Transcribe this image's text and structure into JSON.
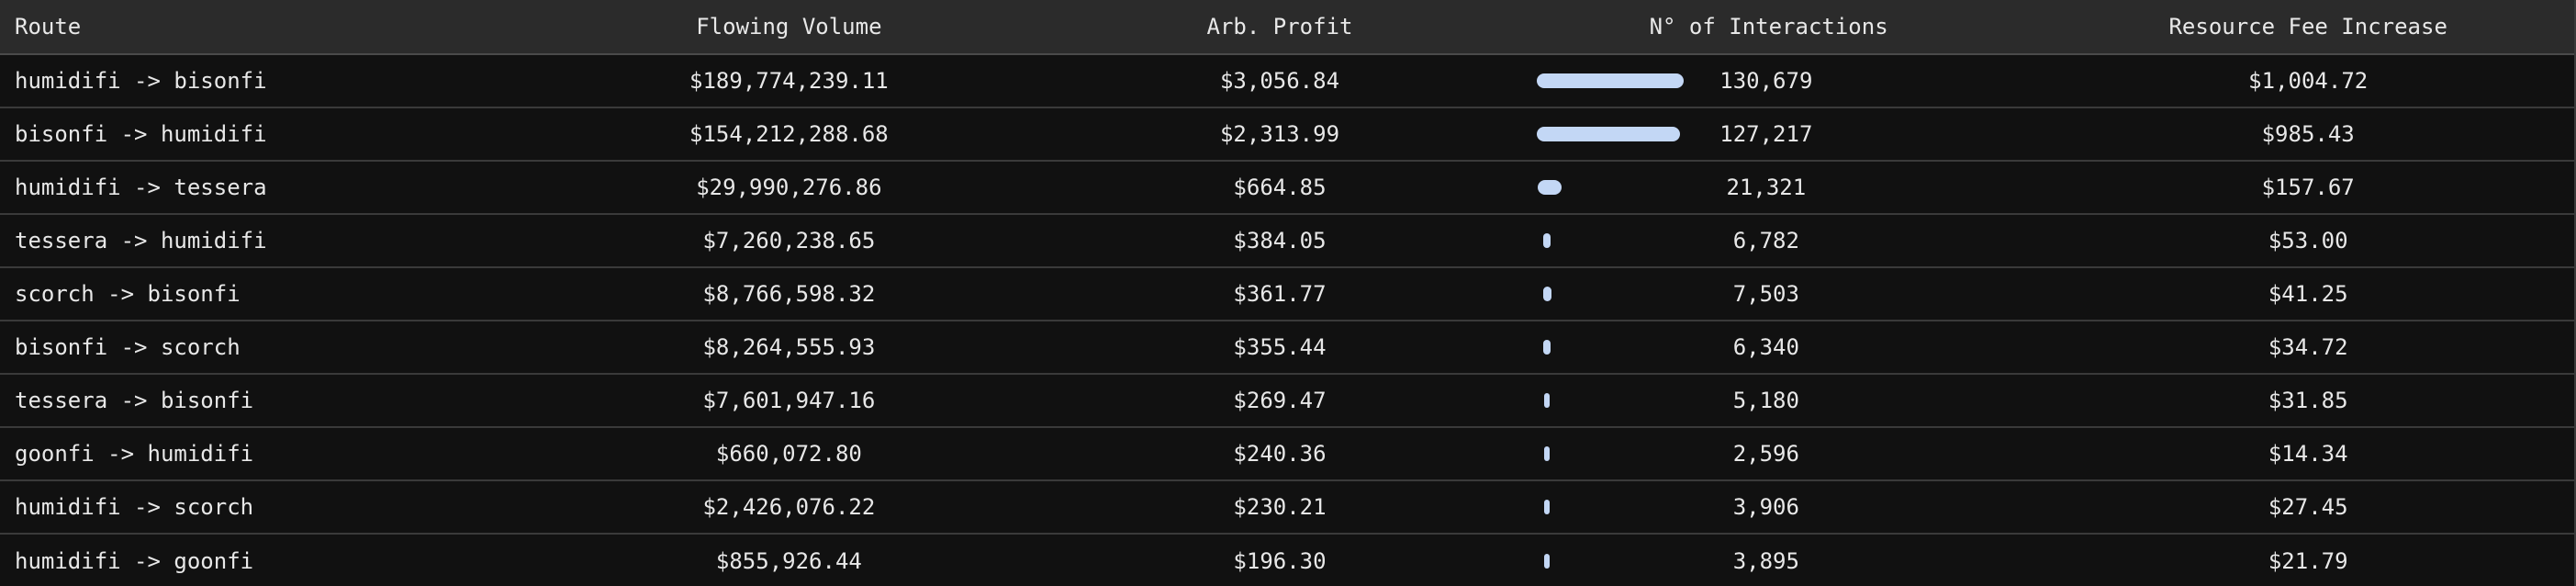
{
  "table": {
    "headers": {
      "route": "Route",
      "flowing_volume": "Flowing Volume",
      "arb_profit": "Arb. Profit",
      "interactions": "N° of Interactions",
      "resource_fee_increase": "Resource Fee Increase"
    },
    "bar_color": "#c3d7f5",
    "rows": [
      {
        "route": "humidifi -> bisonfi",
        "flowing_volume": "$189,774,239.11",
        "arb_profit": "$3,056.84",
        "interactions": "130,679",
        "interactions_value": 130679,
        "resource_fee_increase": "$1,004.72"
      },
      {
        "route": "bisonfi -> humidifi",
        "flowing_volume": "$154,212,288.68",
        "arb_profit": "$2,313.99",
        "interactions": "127,217",
        "interactions_value": 127217,
        "resource_fee_increase": "$985.43"
      },
      {
        "route": "humidifi -> tessera",
        "flowing_volume": "$29,990,276.86",
        "arb_profit": "$664.85",
        "interactions": "21,321",
        "interactions_value": 21321,
        "resource_fee_increase": "$157.67"
      },
      {
        "route": "tessera -> humidifi",
        "flowing_volume": "$7,260,238.65",
        "arb_profit": "$384.05",
        "interactions": "6,782",
        "interactions_value": 6782,
        "resource_fee_increase": "$53.00"
      },
      {
        "route": "scorch -> bisonfi",
        "flowing_volume": "$8,766,598.32",
        "arb_profit": "$361.77",
        "interactions": "7,503",
        "interactions_value": 7503,
        "resource_fee_increase": "$41.25"
      },
      {
        "route": "bisonfi -> scorch",
        "flowing_volume": "$8,264,555.93",
        "arb_profit": "$355.44",
        "interactions": "6,340",
        "interactions_value": 6340,
        "resource_fee_increase": "$34.72"
      },
      {
        "route": "tessera -> bisonfi",
        "flowing_volume": "$7,601,947.16",
        "arb_profit": "$269.47",
        "interactions": "5,180",
        "interactions_value": 5180,
        "resource_fee_increase": "$31.85"
      },
      {
        "route": "goonfi -> humidifi",
        "flowing_volume": "$660,072.80",
        "arb_profit": "$240.36",
        "interactions": "2,596",
        "interactions_value": 2596,
        "resource_fee_increase": "$14.34"
      },
      {
        "route": "humidifi -> scorch",
        "flowing_volume": "$2,426,076.22",
        "arb_profit": "$230.21",
        "interactions": "3,906",
        "interactions_value": 3906,
        "resource_fee_increase": "$27.45"
      },
      {
        "route": "humidifi -> goonfi",
        "flowing_volume": "$855,926.44",
        "arb_profit": "$196.30",
        "interactions": "3,895",
        "interactions_value": 3895,
        "resource_fee_increase": "$21.79"
      }
    ]
  }
}
